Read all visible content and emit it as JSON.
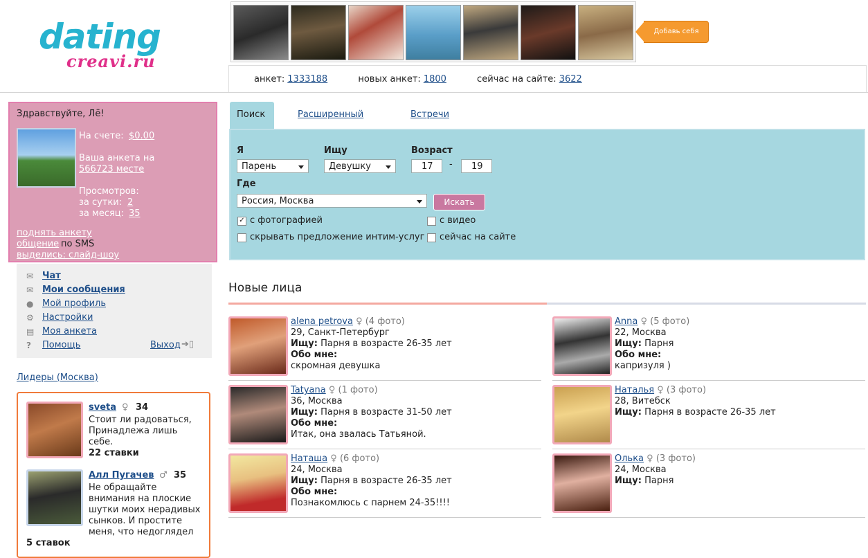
{
  "header": {
    "logo_main": "dating",
    "logo_sub": "creavi.ru",
    "add_button": "Добавь себя",
    "stats": {
      "profiles_label": "анкет:",
      "profiles_value": "1333188",
      "new_label": "новых анкет:",
      "new_value": "1800",
      "online_label": "сейчас на сайте:",
      "online_value": "3622"
    }
  },
  "user": {
    "greeting": "Здравствуйте, Лё!",
    "balance_label": "На счете:",
    "balance_value": "$0.00",
    "rank_label": "Ваша анкета на",
    "rank_value": "566723 месте",
    "views_label": "Просмотров:",
    "day_label": "за сутки:",
    "day_value": "2",
    "month_label": "за месяц:",
    "month_value": "35",
    "link_raise": "поднять анкету",
    "link_sms": "общение",
    "sms_suffix": "по SMS",
    "link_slideshow": "выделись: слайд-шоу"
  },
  "menu": {
    "chat": "Чат",
    "messages": "Мои сообщения",
    "profile": "Мой профиль",
    "settings": "Настройки",
    "my_form": "Моя анкета",
    "help": "Помощь",
    "logout": "Выход"
  },
  "leaders": {
    "title": "Лидеры (Москва)",
    "items": [
      {
        "name": "sveta",
        "age": "34",
        "text1": "Стоит ли радоваться,",
        "text2": "Принадлежа лишь",
        "text3": "себе.",
        "bids": "22 ставки"
      },
      {
        "name": "Алл Пугачев",
        "age": "35",
        "text1": "Не обращайте",
        "text2": "внимания на плоские",
        "text3": "шутки моих нерадивых",
        "text4": "сынков. И простите",
        "text5": "меня, что недоглядел",
        "bids": "5 ставок"
      }
    ]
  },
  "search": {
    "tabs": [
      "Поиск",
      "Расширенный",
      "Встречи"
    ],
    "i_label": "Я",
    "i_value": "Парень",
    "seek_label": "Ищу",
    "seek_value": "Девушку",
    "age_label": "Возраст",
    "age_from": "17",
    "age_dash": "-",
    "age_to": "19",
    "where_label": "Где",
    "where_value": "Россия, Москва",
    "button": "Искать",
    "cb_photo": "с фотографией",
    "cb_video": "с видео",
    "cb_hide": "скрывать предложение интим-услуг",
    "cb_online": "сейчас на сайте"
  },
  "new_faces": {
    "title": "Новые лица",
    "seek_label": "Ищу:",
    "about_label": "Обо мне:",
    "cards": [
      {
        "name": "alena petrova",
        "photos": "(4 фото)",
        "city": "29, Санкт-Петербург",
        "seek": "Парня в возрасте 26-35 лет",
        "about": "скромная девушка"
      },
      {
        "name": "Anna",
        "photos": "(5 фото)",
        "city": "22, Москва",
        "seek": "Парня",
        "about": "капризуля )"
      },
      {
        "name": "Tatyana",
        "photos": "(1 фото)",
        "city": "36, Москва",
        "seek": "Парня в возрасте 31-50 лет",
        "about": "Итак, она звалась Татьяной."
      },
      {
        "name": "Наталья",
        "photos": "(3 фото)",
        "city": "28, Витебск",
        "seek": "Парня в возрасте 26-35 лет",
        "about": ""
      },
      {
        "name": "Наташа",
        "photos": "(6 фото)",
        "city": "24, Москва",
        "seek": "Парня в возрасте 26-35 лет",
        "about": "Познакомлюсь с парнем 24-35!!!!"
      },
      {
        "name": "Олька",
        "photos": "(3 фото)",
        "city": "24, Москва",
        "seek": "Парня",
        "about": ""
      }
    ]
  },
  "colors": {
    "accent": "#27b3cf",
    "pink": "#e0308a",
    "user_box": "#dc9db5",
    "search_panel": "#a6d7e0",
    "leaders_border": "#f07a3a"
  }
}
